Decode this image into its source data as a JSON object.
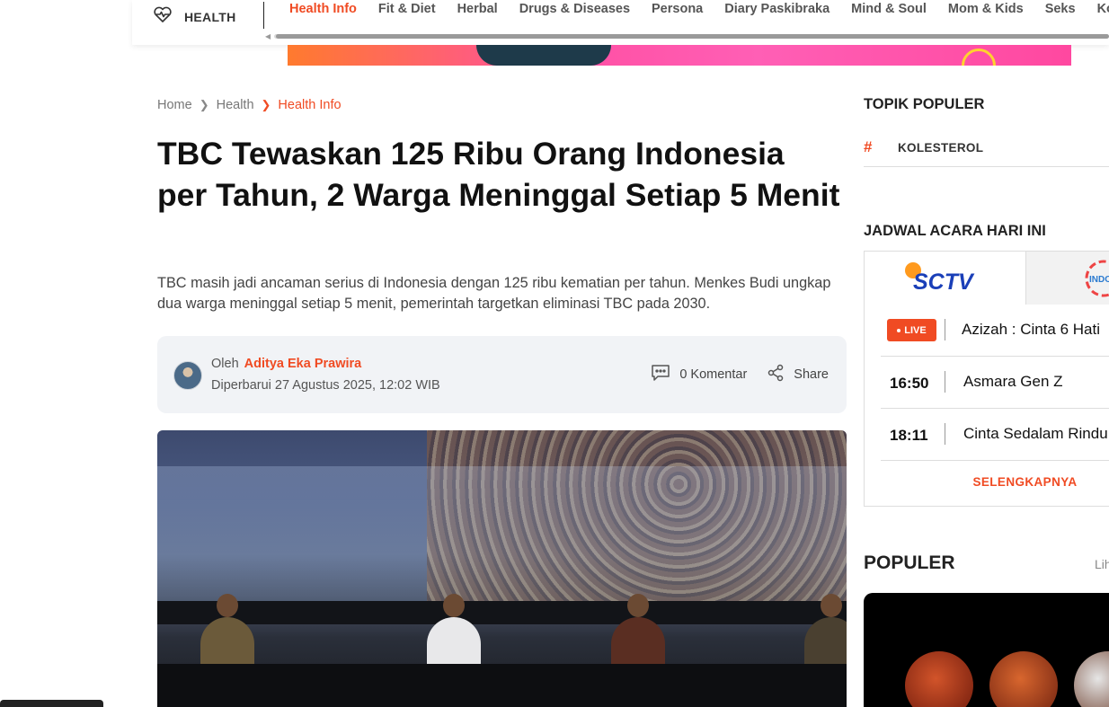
{
  "nav": {
    "section_label": "HEALTH",
    "items": [
      "Health Info",
      "Fit & Diet",
      "Herbal",
      "Drugs & Diseases",
      "Persona",
      "Diary Paskibraka",
      "Mind & Soul",
      "Mom & Kids",
      "Seks",
      "Ko"
    ],
    "active_item": "Health Info",
    "accent_color": "#f04b23"
  },
  "breadcrumb": {
    "items": [
      "Home",
      "Health",
      "Health Info"
    ]
  },
  "article": {
    "title": "TBC Tewaskan 125 Ribu Orang Indonesia per Tahun, 2 Warga Meninggal Setiap 5 Menit",
    "lead": "TBC masih jadi ancaman serius di Indonesia dengan 125 ribu kematian per tahun. Menkes Budi ungkap dua warga meninggal setiap 5 menit, pemerintah targetkan eliminasi TBC pada 2030.",
    "by_prefix": "Oleh",
    "author": "Aditya Eka Prawira",
    "updated": "Diperbarui 27 Agustus 2025, 12:02 WIB",
    "comments": "0 Komentar",
    "share": "Share"
  },
  "sidebar": {
    "topik_title": "TOPIK POPULER",
    "topics": [
      {
        "hash": "#",
        "label": "KOLESTEROL"
      }
    ],
    "jadwal_title": "JADWAL ACARA HARI INI",
    "channel_active": "SCTV",
    "channel_next": "INDOS",
    "live_label": "LIVE",
    "schedule": [
      {
        "time": "",
        "show": "Azizah : Cinta 6 Hati",
        "live": true
      },
      {
        "time": "16:50",
        "show": "Asmara Gen Z",
        "live": false
      },
      {
        "time": "18:11",
        "show": "Cinta Sedalam Rindu",
        "live": false
      }
    ],
    "more_label": "SELENGKAPNYA",
    "populer_title": "POPULER",
    "populer_link": "Lih"
  }
}
